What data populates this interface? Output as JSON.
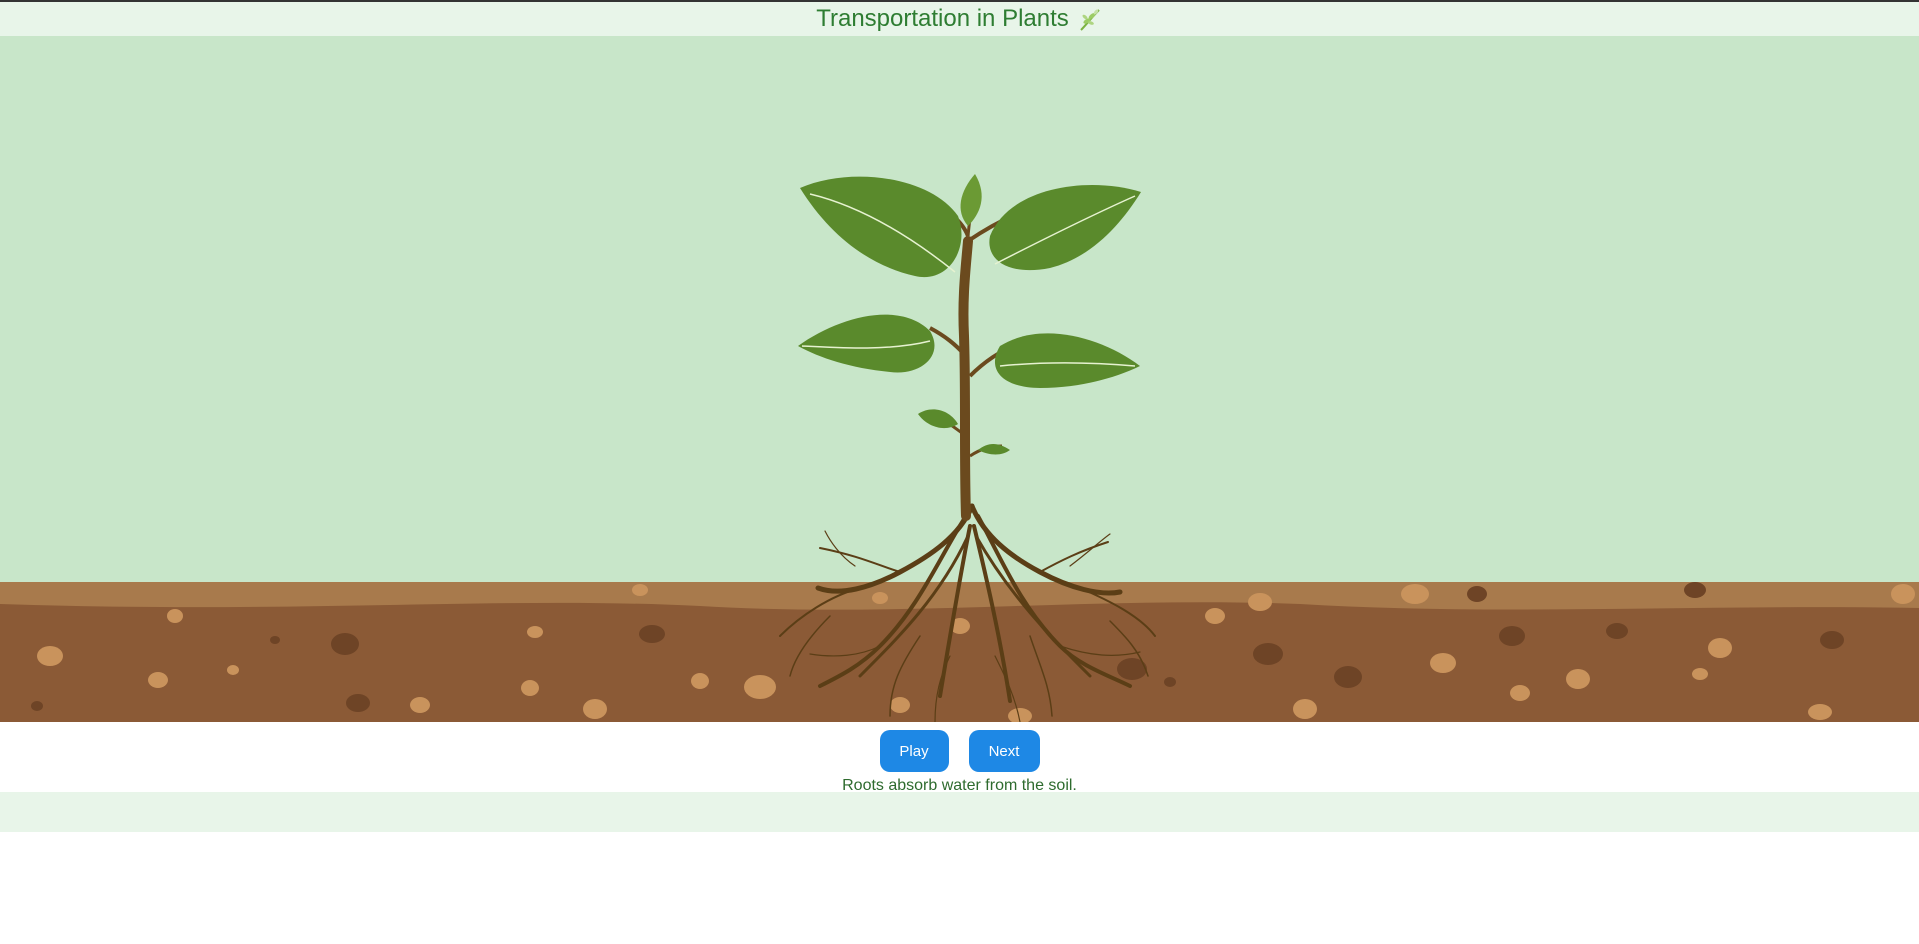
{
  "header": {
    "title": "Transportation in Plants",
    "icon": "herb-icon"
  },
  "scene": {
    "sky_color": "#c8e6c9",
    "soil_top_color": "#a87a4c",
    "soil_color": "#8b5a36",
    "leaf_color": "#5a8a2c",
    "stem_color": "#6b4a1e"
  },
  "controls": {
    "play_label": "Play",
    "next_label": "Next"
  },
  "caption": {
    "text": "Roots absorb water from the soil."
  },
  "colors": {
    "accent": "#1e88e5",
    "title": "#2e7d32",
    "header_bg": "#e8f5e9"
  }
}
